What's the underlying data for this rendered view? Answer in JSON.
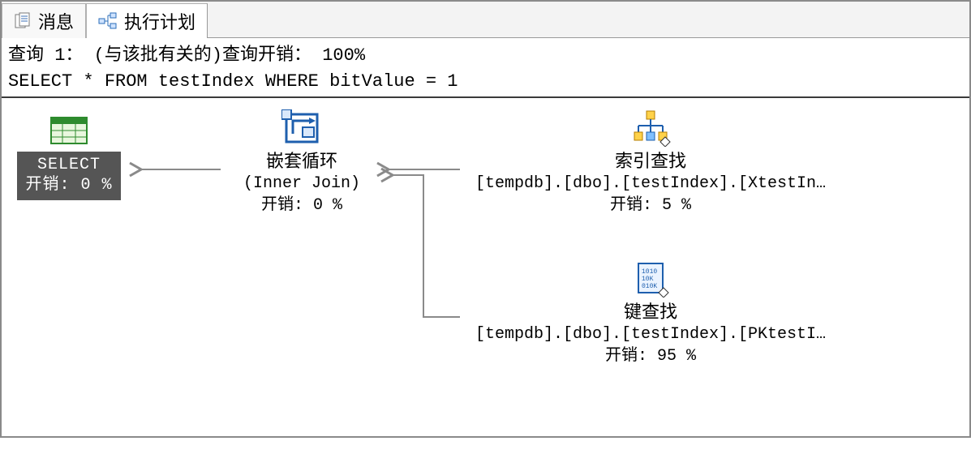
{
  "tabs": {
    "messages_label": "消息",
    "plan_label": "执行计划"
  },
  "query_header": {
    "line1": "查询 1： (与该批有关的)查询开销： 100%",
    "line2": "SELECT * FROM testIndex WHERE bitValue = 1"
  },
  "plan": {
    "select_node": {
      "title": "SELECT",
      "cost": "开销: 0 %"
    },
    "nested_loop": {
      "title": "嵌套循环",
      "subtitle": "(Inner Join)",
      "cost": "开销: 0 %"
    },
    "index_seek": {
      "title": "索引查找",
      "subtitle": "[tempdb].[dbo].[testIndex].[XtestIn…",
      "cost": "开销: 5 %"
    },
    "key_lookup": {
      "title": "键查找",
      "subtitle": "[tempdb].[dbo].[testIndex].[PKtestI…",
      "cost": "开销: 95 %"
    }
  }
}
